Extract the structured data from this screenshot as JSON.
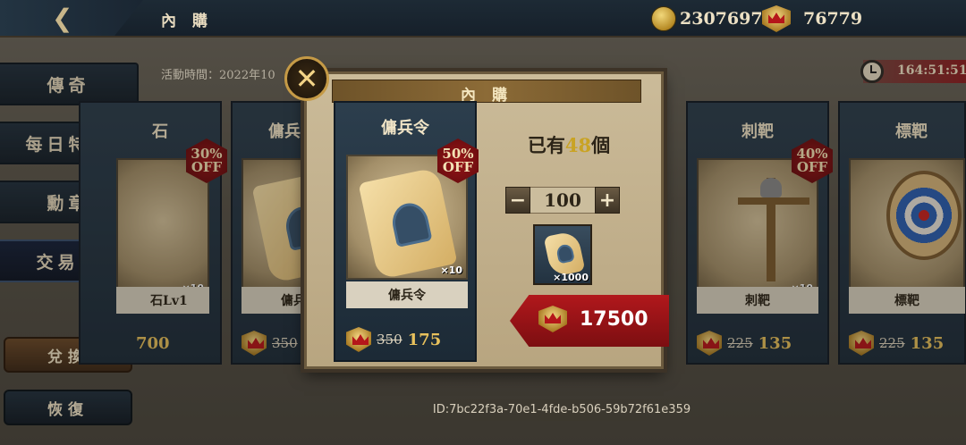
{
  "header": {
    "title": "內 購",
    "back_icon": "back-arrow-icon",
    "gold": "2307697",
    "crowns": "76779"
  },
  "event": {
    "time_label": "活動時間：2022年10",
    "timer": "164:51:51"
  },
  "sidebar": {
    "items": [
      {
        "label": "傳奇"
      },
      {
        "label": "每日特惠"
      },
      {
        "label": "勳章"
      },
      {
        "label": "交易行"
      }
    ],
    "exchange_label": "兌換",
    "restore_label": "恢復"
  },
  "cards": [
    {
      "title": "石",
      "badge_pct": "30%",
      "badge_off": "OFF",
      "name": "石Lv1",
      "qty": "×10",
      "old": "",
      "new": "700"
    },
    {
      "title": "傭兵",
      "badge_pct": "",
      "badge_off": "",
      "name": "傭兵",
      "qty": "",
      "old": "350",
      "new": ""
    },
    {
      "title": "刺靶",
      "badge_pct": "40%",
      "badge_off": "OFF",
      "name": "刺靶",
      "qty": "×10",
      "old": "225",
      "new": "135"
    },
    {
      "title": "標靶",
      "badge_pct": "",
      "badge_off": "",
      "name": "標靶",
      "qty": "",
      "old": "225",
      "new": "135"
    }
  ],
  "dialog": {
    "title": "內 購",
    "item_title": "傭兵令",
    "badge_pct": "50%",
    "badge_off": "OFF",
    "item_qty": "×10",
    "item_name": "傭兵令",
    "old_price": "350",
    "new_price": "175",
    "owned_prefix": "已有",
    "owned_count": "48",
    "owned_suffix": "個",
    "quantity": "100",
    "minus": "−",
    "plus": "+",
    "mini_qty": "×1000",
    "total_price": "17500",
    "close_icon": "close-icon"
  },
  "footer": {
    "id_text": "ID:7bc22f3a-70e1-4fde-b506-59b72f61e359"
  },
  "colors": {
    "accent_gold": "#e8c15c",
    "sale_red": "#9a1619",
    "button_red": "#b1181c"
  }
}
